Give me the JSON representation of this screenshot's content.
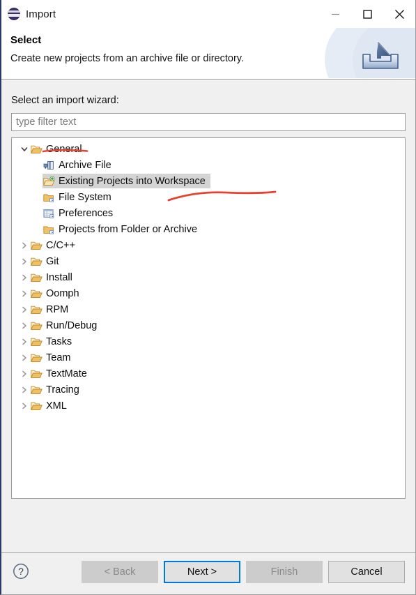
{
  "window": {
    "title": "Import",
    "icon": "eclipse-icon",
    "controls": {
      "minimize": "minimize-icon",
      "maximize": "maximize-icon",
      "close": "close-icon"
    }
  },
  "header": {
    "title": "Select",
    "description": "Create new projects from an archive file or directory.",
    "banner_icon": "import-arrow-tray-icon"
  },
  "body": {
    "wizard_label": "Select an import wizard:",
    "filter": {
      "value": "",
      "placeholder": "type filter text"
    },
    "tree": [
      {
        "label": "General",
        "level": 0,
        "expanded": true,
        "icon": "open-folder-icon",
        "selected": false
      },
      {
        "label": "Archive File",
        "level": 1,
        "expanded": null,
        "icon": "archive-file-icon",
        "selected": false
      },
      {
        "label": "Existing Projects into Workspace",
        "level": 1,
        "expanded": null,
        "icon": "import-project-folder-icon",
        "selected": true
      },
      {
        "label": "File System",
        "level": 1,
        "expanded": null,
        "icon": "file-system-folder-icon",
        "selected": false
      },
      {
        "label": "Preferences",
        "level": 1,
        "expanded": null,
        "icon": "preferences-icon",
        "selected": false
      },
      {
        "label": "Projects from Folder or Archive",
        "level": 1,
        "expanded": null,
        "icon": "file-system-folder-icon",
        "selected": false
      },
      {
        "label": "C/C++",
        "level": 0,
        "expanded": false,
        "icon": "closed-folder-icon",
        "selected": false
      },
      {
        "label": "Git",
        "level": 0,
        "expanded": false,
        "icon": "closed-folder-icon",
        "selected": false
      },
      {
        "label": "Install",
        "level": 0,
        "expanded": false,
        "icon": "closed-folder-icon",
        "selected": false
      },
      {
        "label": "Oomph",
        "level": 0,
        "expanded": false,
        "icon": "closed-folder-icon",
        "selected": false
      },
      {
        "label": "RPM",
        "level": 0,
        "expanded": false,
        "icon": "closed-folder-icon",
        "selected": false
      },
      {
        "label": "Run/Debug",
        "level": 0,
        "expanded": false,
        "icon": "closed-folder-icon",
        "selected": false
      },
      {
        "label": "Tasks",
        "level": 0,
        "expanded": false,
        "icon": "closed-folder-icon",
        "selected": false
      },
      {
        "label": "Team",
        "level": 0,
        "expanded": false,
        "icon": "closed-folder-icon",
        "selected": false
      },
      {
        "label": "TextMate",
        "level": 0,
        "expanded": false,
        "icon": "closed-folder-icon",
        "selected": false
      },
      {
        "label": "Tracing",
        "level": 0,
        "expanded": false,
        "icon": "closed-folder-icon",
        "selected": false
      },
      {
        "label": "XML",
        "level": 0,
        "expanded": false,
        "icon": "closed-folder-icon",
        "selected": false
      }
    ],
    "annotations": [
      {
        "name": "red-underline-general",
        "color": "#e8412f"
      },
      {
        "name": "red-line-file-system",
        "color": "#e8412f"
      }
    ]
  },
  "footer": {
    "help_icon": "help-question-icon",
    "buttons": [
      {
        "label": "< Back",
        "state": "disabled",
        "name": "back-button"
      },
      {
        "label": "Next >",
        "state": "focused",
        "name": "next-button"
      },
      {
        "label": "Finish",
        "state": "disabled",
        "name": "finish-button"
      },
      {
        "label": "Cancel",
        "state": "enabled",
        "name": "cancel-button"
      }
    ]
  },
  "colors": {
    "accent": "#0078d7",
    "annotation_red": "#e8412f",
    "selection_gray": "#d4d4d4",
    "folder_gold": "#f0c067",
    "window_border": "#2b3a67"
  }
}
